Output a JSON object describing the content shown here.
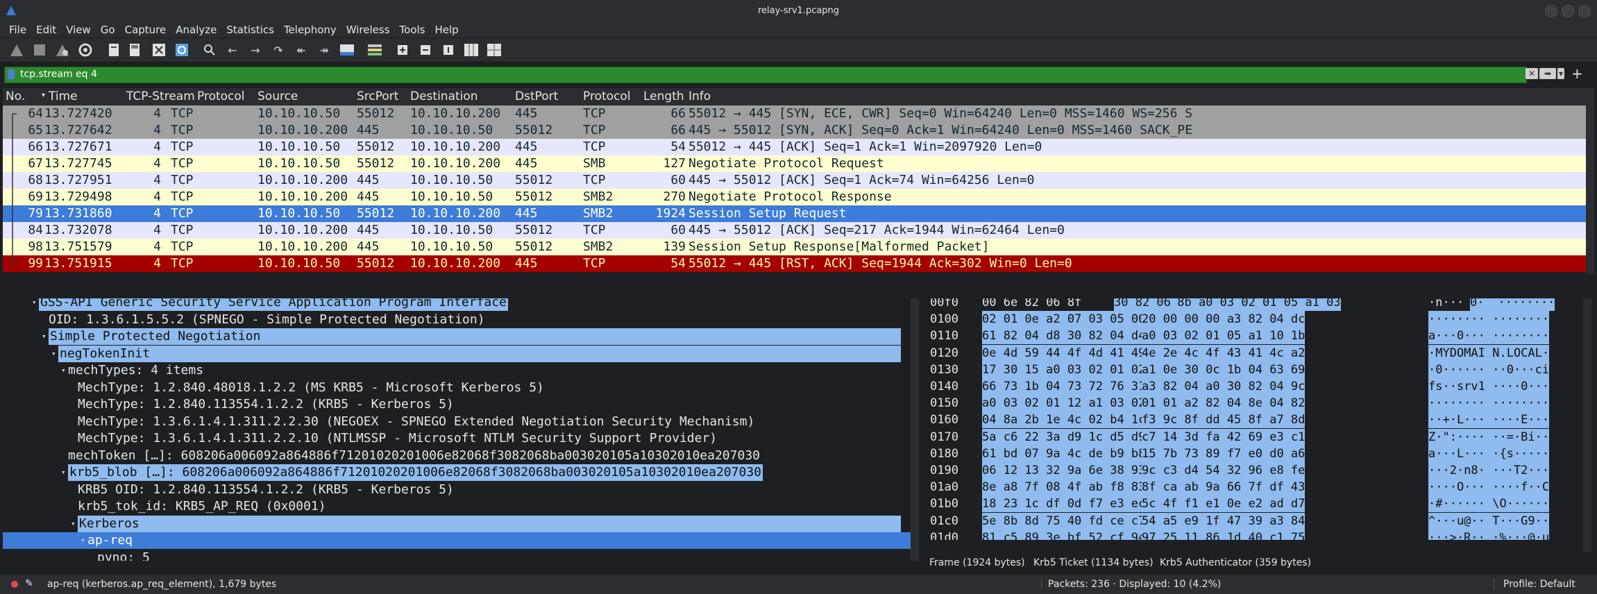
{
  "window": {
    "title": "relay-srv1.pcapng"
  },
  "menu": [
    "File",
    "Edit",
    "View",
    "Go",
    "Capture",
    "Analyze",
    "Statistics",
    "Telephony",
    "Wireless",
    "Tools",
    "Help"
  ],
  "filter": {
    "value": "tcp.stream eq 4"
  },
  "packet_list": {
    "columns": [
      "No.",
      "Time",
      "TCP-Stream",
      "Protocol",
      "Source",
      "SrcPort",
      "Destination",
      "DstPort",
      "Protocol",
      "Length",
      "Info"
    ],
    "rows": [
      {
        "no": "64",
        "time": "13.727420",
        "stream": "4",
        "proto": "TCP",
        "src": "10.10.10.50",
        "sport": "55012",
        "dst": "10.10.10.200",
        "dport": "445",
        "proto2": "TCP",
        "len": "66",
        "info": "55012 → 445 [SYN, ECE, CWR] Seq=0 Win=64240 Len=0 MSS=1460 WS=256 S",
        "bg": "#a0a0a0",
        "fg": "#12272e"
      },
      {
        "no": "65",
        "time": "13.727642",
        "stream": "4",
        "proto": "TCP",
        "src": "10.10.10.200",
        "sport": "445",
        "dst": "10.10.10.50",
        "dport": "55012",
        "proto2": "TCP",
        "len": "66",
        "info": "445 → 55012 [SYN, ACK] Seq=0 Ack=1 Win=64240 Len=0 MSS=1460 SACK_PE",
        "bg": "#a0a0a0",
        "fg": "#12272e"
      },
      {
        "no": "66",
        "time": "13.727671",
        "stream": "4",
        "proto": "TCP",
        "src": "10.10.10.50",
        "sport": "55012",
        "dst": "10.10.10.200",
        "dport": "445",
        "proto2": "TCP",
        "len": "54",
        "info": "55012 → 445 [ACK] Seq=1 Ack=1 Win=2097920 Len=0",
        "bg": "#e7e6ff",
        "fg": "#12272e"
      },
      {
        "no": "67",
        "time": "13.727745",
        "stream": "4",
        "proto": "TCP",
        "src": "10.10.10.50",
        "sport": "55012",
        "dst": "10.10.10.200",
        "dport": "445",
        "proto2": "SMB",
        "len": "127",
        "info": "Negotiate Protocol Request",
        "bg": "#feffd0",
        "fg": "#12272e"
      },
      {
        "no": "68",
        "time": "13.727951",
        "stream": "4",
        "proto": "TCP",
        "src": "10.10.10.200",
        "sport": "445",
        "dst": "10.10.10.50",
        "dport": "55012",
        "proto2": "TCP",
        "len": "60",
        "info": "445 → 55012 [ACK] Seq=1 Ack=74 Win=64256 Len=0",
        "bg": "#e7e6ff",
        "fg": "#12272e"
      },
      {
        "no": "69",
        "time": "13.729498",
        "stream": "4",
        "proto": "TCP",
        "src": "10.10.10.200",
        "sport": "445",
        "dst": "10.10.10.50",
        "dport": "55012",
        "proto2": "SMB2",
        "len": "270",
        "info": "Negotiate Protocol Response",
        "bg": "#feffd0",
        "fg": "#12272e"
      },
      {
        "no": "79",
        "time": "13.731860",
        "stream": "4",
        "proto": "TCP",
        "src": "10.10.10.50",
        "sport": "55012",
        "dst": "10.10.10.200",
        "dport": "445",
        "proto2": "SMB2",
        "len": "1924",
        "info": "Session Setup Request",
        "bg": "#3d7cd8",
        "fg": "#ffffff"
      },
      {
        "no": "84",
        "time": "13.732078",
        "stream": "4",
        "proto": "TCP",
        "src": "10.10.10.200",
        "sport": "445",
        "dst": "10.10.10.50",
        "dport": "55012",
        "proto2": "TCP",
        "len": "60",
        "info": "445 → 55012 [ACK] Seq=217 Ack=1944 Win=62464 Len=0",
        "bg": "#e7e6ff",
        "fg": "#12272e"
      },
      {
        "no": "98",
        "time": "13.751579",
        "stream": "4",
        "proto": "TCP",
        "src": "10.10.10.200",
        "sport": "445",
        "dst": "10.10.10.50",
        "dport": "55012",
        "proto2": "SMB2",
        "len": "139",
        "info": "Session Setup Response[Malformed Packet]",
        "bg": "#feffd0",
        "fg": "#12272e"
      },
      {
        "no": "99",
        "time": "13.751915",
        "stream": "4",
        "proto": "TCP",
        "src": "10.10.10.50",
        "sport": "55012",
        "dst": "10.10.10.200",
        "dport": "445",
        "proto2": "TCP",
        "len": "54",
        "info": "55012 → 445 [RST, ACK] Seq=1944 Ack=302 Win=0 Len=0",
        "bg": "#a40000",
        "fg": "#fffc9c"
      }
    ]
  },
  "detail": [
    {
      "text": "GSS-API Generic Security Service Application Program Interface",
      "hl": true,
      "exp": "open"
    },
    {
      "text": "OID: 1.3.6.1.5.5.2 (SPNEGO - Simple Protected Negotiation)",
      "hl": false,
      "exp": ""
    },
    {
      "text": "Simple Protected Negotiation",
      "hl": true,
      "exp": "open"
    },
    {
      "text": "negTokenInit",
      "hl": true,
      "exp": "open"
    },
    {
      "text": "mechTypes: 4 items",
      "hl": false,
      "exp": "open"
    },
    {
      "text": "MechType: 1.2.840.48018.1.2.2 (MS KRB5 - Microsoft Kerberos 5)",
      "hl": false,
      "exp": ""
    },
    {
      "text": "MechType: 1.2.840.113554.1.2.2 (KRB5 - Kerberos 5)",
      "hl": false,
      "exp": ""
    },
    {
      "text": "MechType: 1.3.6.1.4.1.311.2.2.30 (NEGOEX - SPNEGO Extended Negotiation Security Mechanism)",
      "hl": false,
      "exp": ""
    },
    {
      "text": "MechType: 1.3.6.1.4.1.311.2.2.10 (NTLMSSP - Microsoft NTLM Security Support Provider)",
      "hl": false,
      "exp": ""
    },
    {
      "text": "mechToken […]: 608206a006092a864886f71201020201006e82068f3082068ba003020105a10302010ea207030",
      "hl": false,
      "exp": ""
    },
    {
      "text": "krb5_blob […]: 608206a006092a864886f71201020201006e82068f3082068ba003020105a10302010ea207030",
      "hl": true,
      "exp": "open"
    },
    {
      "text": "KRB5 OID: 1.2.840.113554.1.2.2 (KRB5 - Kerberos 5)",
      "hl": false,
      "exp": ""
    },
    {
      "text": "krb5_tok_id: KRB5_AP_REQ (0x0001)",
      "hl": false,
      "exp": ""
    },
    {
      "text": "Kerberos",
      "hl": true,
      "exp": "open"
    },
    {
      "text": "ap-req",
      "hl": false,
      "exp": "open",
      "sel": true
    },
    {
      "text": "pvno: 5",
      "hl": false,
      "exp": ""
    }
  ],
  "bytes": [
    {
      "off": "00f0",
      "hex1": "00 6e 82 06 8f ",
      "hex1s": "30 82 06",
      "hex2": " 8b a0 03 02 01 05 a1 03",
      "asc1": "·n···",
      "asc1s": "0·",
      "asc2": "  ········"
    },
    {
      "off": "0100",
      "hex1": "",
      "hex1s": "02 01 0e a2 07 03 05 00",
      "hex2": "20 00 00 00 a3 82 04 dc",
      "asc1": "",
      "asc1s": "········",
      "asc2": " ········"
    },
    {
      "off": "0110",
      "hex1": "",
      "hex1s": "61 82 04 d8 30 82 04 d4",
      "hex2": "a0 03 02 01 05 a1 10 1b",
      "asc1": "",
      "asc1s": "a···0···",
      "asc2": " ········"
    },
    {
      "off": "0120",
      "hex1": "",
      "hex1s": "0e 4d 59 44 4f 4d 41 49",
      "hex2": "4e 2e 4c 4f 43 41 4c a2",
      "asc1": "",
      "asc1s": "·MYDOMAI",
      "asc2": " N.LOCAL·"
    },
    {
      "off": "0130",
      "hex1": "",
      "hex1s": "17 30 15 a0 03 02 01 02",
      "hex2": "a1 0e 30 0c 1b 04 63 69",
      "asc1": "",
      "asc1s": "·0······",
      "asc2": " ··0···ci"
    },
    {
      "off": "0140",
      "hex1": "",
      "hex1s": "66 73 1b 04 73 72 76 31",
      "hex2": "a3 82 04 a0 30 82 04 9c",
      "asc1": "",
      "asc1s": "fs··srv1",
      "asc2": " ····0···"
    },
    {
      "off": "0150",
      "hex1": "",
      "hex1s": "a0 03 02 01 12 a1 03 02",
      "hex2": "01 01 a2 82 04 8e 04 82",
      "asc1": "",
      "asc1s": "········",
      "asc2": " ········"
    },
    {
      "off": "0160",
      "hex1": "",
      "hex1s": "04 8a 2b 1e 4c 02 b4 1c",
      "hex2": "f3 9c 8f dd 45 8f a7 8d",
      "asc1": "",
      "asc1s": "··+·L···",
      "asc2": " ····E···"
    },
    {
      "off": "0170",
      "hex1": "",
      "hex1s": "5a c6 22 3a d9 1c d5 d9",
      "hex2": "c7 14 3d fa 42 69 e3 c1",
      "asc1": "",
      "asc1s": "Z·\":····",
      "asc2": " ··=·Bi··"
    },
    {
      "off": "0180",
      "hex1": "",
      "hex1s": "61 bd 07 9a 4c de b9 b8",
      "hex2": "15 7b 73 89 f7 e0 d0 a6",
      "asc1": "",
      "asc1s": "a···L···",
      "asc2": " ·{s·····"
    },
    {
      "off": "0190",
      "hex1": "",
      "hex1s": "06 12 13 32 9a 6e 38 93",
      "hex2": "9c c3 d4 54 32 96 e8 fe",
      "asc1": "",
      "asc1s": "···2·n8·",
      "asc2": " ···T2···"
    },
    {
      "off": "01a0",
      "hex1": "",
      "hex1s": "8e a8 7f 08 4f ab f8 83",
      "hex2": "8f ca ab 9a 66 7f df 43",
      "asc1": "",
      "asc1s": "····O···",
      "asc2": " ····f··C"
    },
    {
      "off": "01b0",
      "hex1": "",
      "hex1s": "18 23 1c df 0d f7 e3 ec",
      "hex2": "5c 4f f1 e1 0e e2 ad d7",
      "asc1": "",
      "asc1s": "·#······",
      "asc2": " \\O······"
    },
    {
      "off": "01c0",
      "hex1": "",
      "hex1s": "5e 8b 8d 75 40 fd ce c7",
      "hex2": "54 a5 e9 1f 47 39 a3 84",
      "asc1": "",
      "asc1s": "^···u@··",
      "asc2": " T···G9··"
    },
    {
      "off": "01d0",
      "hex1": "",
      "hex1s": "81 c5 89 3e bf 52 cf 94",
      "hex2": "97 25 11 86 1d 40 c1 75",
      "asc1": "",
      "asc1s": "···>·R··",
      "asc2": " ·%···@·u"
    }
  ],
  "byte_tabs": [
    "Frame (1924 bytes)",
    "Krb5 Ticket (1134 bytes)",
    "Krb5 Authenticator (359 bytes)"
  ],
  "status": {
    "field": "ap-req (kerberos.ap_req_element), 1,679 bytes",
    "packets": "Packets: 236 · Displayed: 10 (4.2%)",
    "profile": "Profile: Default"
  }
}
